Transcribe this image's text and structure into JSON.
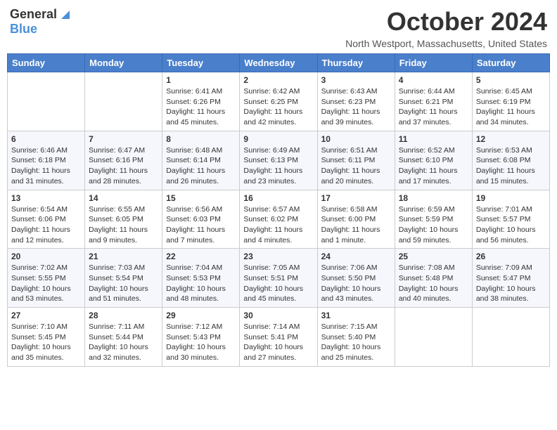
{
  "header": {
    "logo_general": "General",
    "logo_blue": "Blue",
    "title": "October 2024",
    "location": "North Westport, Massachusetts, United States"
  },
  "weekdays": [
    "Sunday",
    "Monday",
    "Tuesday",
    "Wednesday",
    "Thursday",
    "Friday",
    "Saturday"
  ],
  "weeks": [
    [
      {
        "day": "",
        "info": ""
      },
      {
        "day": "",
        "info": ""
      },
      {
        "day": "1",
        "info": "Sunrise: 6:41 AM\nSunset: 6:26 PM\nDaylight: 11 hours and 45 minutes."
      },
      {
        "day": "2",
        "info": "Sunrise: 6:42 AM\nSunset: 6:25 PM\nDaylight: 11 hours and 42 minutes."
      },
      {
        "day": "3",
        "info": "Sunrise: 6:43 AM\nSunset: 6:23 PM\nDaylight: 11 hours and 39 minutes."
      },
      {
        "day": "4",
        "info": "Sunrise: 6:44 AM\nSunset: 6:21 PM\nDaylight: 11 hours and 37 minutes."
      },
      {
        "day": "5",
        "info": "Sunrise: 6:45 AM\nSunset: 6:19 PM\nDaylight: 11 hours and 34 minutes."
      }
    ],
    [
      {
        "day": "6",
        "info": "Sunrise: 6:46 AM\nSunset: 6:18 PM\nDaylight: 11 hours and 31 minutes."
      },
      {
        "day": "7",
        "info": "Sunrise: 6:47 AM\nSunset: 6:16 PM\nDaylight: 11 hours and 28 minutes."
      },
      {
        "day": "8",
        "info": "Sunrise: 6:48 AM\nSunset: 6:14 PM\nDaylight: 11 hours and 26 minutes."
      },
      {
        "day": "9",
        "info": "Sunrise: 6:49 AM\nSunset: 6:13 PM\nDaylight: 11 hours and 23 minutes."
      },
      {
        "day": "10",
        "info": "Sunrise: 6:51 AM\nSunset: 6:11 PM\nDaylight: 11 hours and 20 minutes."
      },
      {
        "day": "11",
        "info": "Sunrise: 6:52 AM\nSunset: 6:10 PM\nDaylight: 11 hours and 17 minutes."
      },
      {
        "day": "12",
        "info": "Sunrise: 6:53 AM\nSunset: 6:08 PM\nDaylight: 11 hours and 15 minutes."
      }
    ],
    [
      {
        "day": "13",
        "info": "Sunrise: 6:54 AM\nSunset: 6:06 PM\nDaylight: 11 hours and 12 minutes."
      },
      {
        "day": "14",
        "info": "Sunrise: 6:55 AM\nSunset: 6:05 PM\nDaylight: 11 hours and 9 minutes."
      },
      {
        "day": "15",
        "info": "Sunrise: 6:56 AM\nSunset: 6:03 PM\nDaylight: 11 hours and 7 minutes."
      },
      {
        "day": "16",
        "info": "Sunrise: 6:57 AM\nSunset: 6:02 PM\nDaylight: 11 hours and 4 minutes."
      },
      {
        "day": "17",
        "info": "Sunrise: 6:58 AM\nSunset: 6:00 PM\nDaylight: 11 hours and 1 minute."
      },
      {
        "day": "18",
        "info": "Sunrise: 6:59 AM\nSunset: 5:59 PM\nDaylight: 10 hours and 59 minutes."
      },
      {
        "day": "19",
        "info": "Sunrise: 7:01 AM\nSunset: 5:57 PM\nDaylight: 10 hours and 56 minutes."
      }
    ],
    [
      {
        "day": "20",
        "info": "Sunrise: 7:02 AM\nSunset: 5:55 PM\nDaylight: 10 hours and 53 minutes."
      },
      {
        "day": "21",
        "info": "Sunrise: 7:03 AM\nSunset: 5:54 PM\nDaylight: 10 hours and 51 minutes."
      },
      {
        "day": "22",
        "info": "Sunrise: 7:04 AM\nSunset: 5:53 PM\nDaylight: 10 hours and 48 minutes."
      },
      {
        "day": "23",
        "info": "Sunrise: 7:05 AM\nSunset: 5:51 PM\nDaylight: 10 hours and 45 minutes."
      },
      {
        "day": "24",
        "info": "Sunrise: 7:06 AM\nSunset: 5:50 PM\nDaylight: 10 hours and 43 minutes."
      },
      {
        "day": "25",
        "info": "Sunrise: 7:08 AM\nSunset: 5:48 PM\nDaylight: 10 hours and 40 minutes."
      },
      {
        "day": "26",
        "info": "Sunrise: 7:09 AM\nSunset: 5:47 PM\nDaylight: 10 hours and 38 minutes."
      }
    ],
    [
      {
        "day": "27",
        "info": "Sunrise: 7:10 AM\nSunset: 5:45 PM\nDaylight: 10 hours and 35 minutes."
      },
      {
        "day": "28",
        "info": "Sunrise: 7:11 AM\nSunset: 5:44 PM\nDaylight: 10 hours and 32 minutes."
      },
      {
        "day": "29",
        "info": "Sunrise: 7:12 AM\nSunset: 5:43 PM\nDaylight: 10 hours and 30 minutes."
      },
      {
        "day": "30",
        "info": "Sunrise: 7:14 AM\nSunset: 5:41 PM\nDaylight: 10 hours and 27 minutes."
      },
      {
        "day": "31",
        "info": "Sunrise: 7:15 AM\nSunset: 5:40 PM\nDaylight: 10 hours and 25 minutes."
      },
      {
        "day": "",
        "info": ""
      },
      {
        "day": "",
        "info": ""
      }
    ]
  ]
}
